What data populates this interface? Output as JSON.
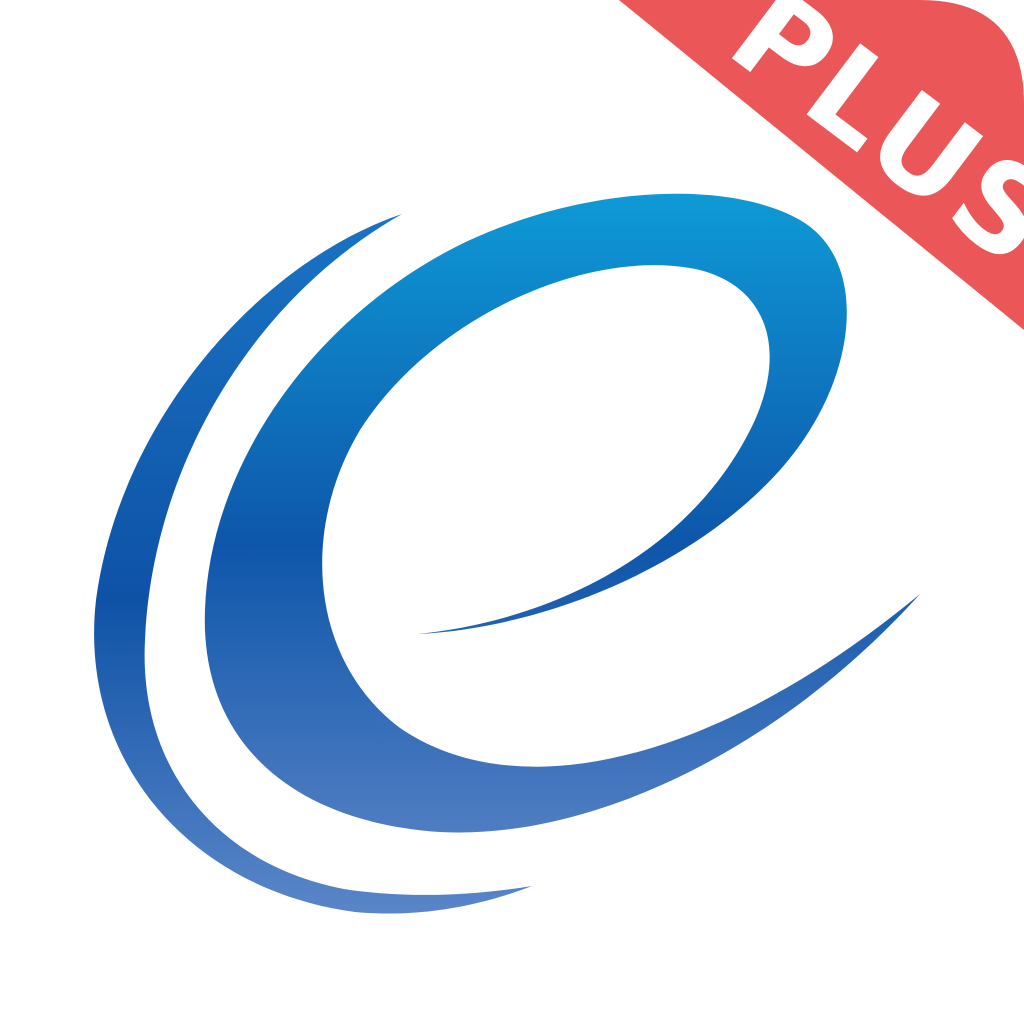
{
  "app_icon": {
    "logo_icon": "swoosh-e-icon",
    "badge": {
      "label": "PLUS",
      "color": "#EB5659",
      "text_color": "#FFFFFF"
    },
    "colors": {
      "background": "#FFFFFF",
      "logo_light": "#0E9AD6",
      "logo_mid": "#0E56AA",
      "logo_dark": "#4F7DC2"
    }
  }
}
